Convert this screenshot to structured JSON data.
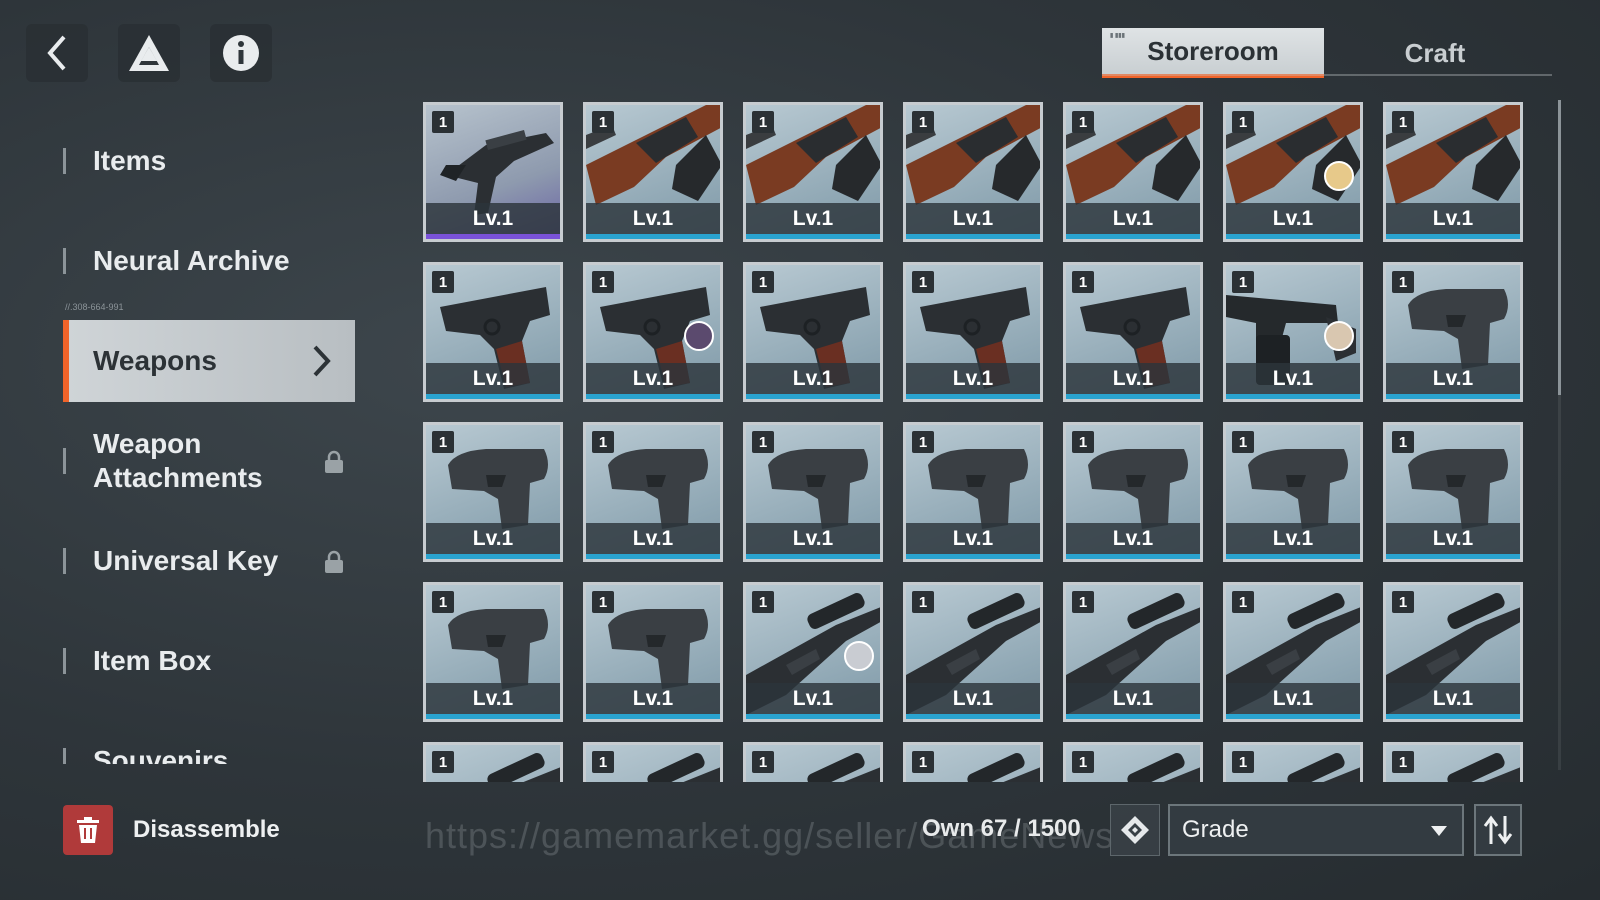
{
  "header": {
    "back_icon": "chevron-left-icon",
    "logo_icon": "triangle-logo-icon",
    "info_icon": "info-icon",
    "tabs": [
      {
        "label": "Storeroom",
        "active": true
      },
      {
        "label": "Craft",
        "active": false
      }
    ]
  },
  "sidebar": {
    "items": [
      {
        "label": "Items",
        "active": false,
        "locked": false
      },
      {
        "label": "Neural Archive",
        "active": false,
        "locked": false
      },
      {
        "label": "Weapons",
        "active": true,
        "locked": false
      },
      {
        "label": "Weapon Attachments",
        "active": false,
        "locked": true
      },
      {
        "label": "Universal Key",
        "active": false,
        "locked": true
      },
      {
        "label": "Item Box",
        "active": false,
        "locked": false
      },
      {
        "label": "Souvenirs",
        "active": false,
        "locked": false
      }
    ],
    "micro_label": "//.308-664-991"
  },
  "grid": {
    "level_label": "Lv.1",
    "rows": [
      [
        {
          "count": "1",
          "weapon": "smg",
          "rarity": "purple",
          "avatar": false
        },
        {
          "count": "1",
          "weapon": "rifle",
          "rarity": "blue",
          "avatar": false
        },
        {
          "count": "1",
          "weapon": "rifle",
          "rarity": "blue",
          "avatar": false
        },
        {
          "count": "1",
          "weapon": "rifle",
          "rarity": "blue",
          "avatar": false
        },
        {
          "count": "1",
          "weapon": "rifle",
          "rarity": "blue",
          "avatar": false
        },
        {
          "count": "1",
          "weapon": "rifle",
          "rarity": "blue",
          "avatar": true,
          "avatar_color": "#e7c98a"
        },
        {
          "count": "1",
          "weapon": "rifle",
          "rarity": "blue",
          "avatar": false
        }
      ],
      [
        {
          "count": "1",
          "weapon": "pistol",
          "rarity": "blue",
          "avatar": false
        },
        {
          "count": "1",
          "weapon": "pistol",
          "rarity": "blue",
          "avatar": true,
          "avatar_color": "#5b4a6e"
        },
        {
          "count": "1",
          "weapon": "pistol",
          "rarity": "blue",
          "avatar": false
        },
        {
          "count": "1",
          "weapon": "pistol",
          "rarity": "blue",
          "avatar": false
        },
        {
          "count": "1",
          "weapon": "pistol",
          "rarity": "blue",
          "avatar": false
        },
        {
          "count": "1",
          "weapon": "tommy",
          "rarity": "blue",
          "avatar": true,
          "avatar_color": "#d9c7b0"
        },
        {
          "count": "1",
          "weapon": "compact",
          "rarity": "blue",
          "avatar": false
        }
      ],
      [
        {
          "count": "1",
          "weapon": "compact",
          "rarity": "blue",
          "avatar": false
        },
        {
          "count": "1",
          "weapon": "compact",
          "rarity": "blue",
          "avatar": false
        },
        {
          "count": "1",
          "weapon": "compact",
          "rarity": "blue",
          "avatar": false
        },
        {
          "count": "1",
          "weapon": "compact",
          "rarity": "blue",
          "avatar": false
        },
        {
          "count": "1",
          "weapon": "compact",
          "rarity": "blue",
          "avatar": false
        },
        {
          "count": "1",
          "weapon": "compact",
          "rarity": "blue",
          "avatar": false
        },
        {
          "count": "1",
          "weapon": "compact",
          "rarity": "blue",
          "avatar": false
        }
      ],
      [
        {
          "count": "1",
          "weapon": "compact",
          "rarity": "blue",
          "avatar": false
        },
        {
          "count": "1",
          "weapon": "compact",
          "rarity": "blue",
          "avatar": false
        },
        {
          "count": "1",
          "weapon": "sniper",
          "rarity": "blue",
          "avatar": true,
          "avatar_color": "#c9ccd2"
        },
        {
          "count": "1",
          "weapon": "sniper",
          "rarity": "blue",
          "avatar": false
        },
        {
          "count": "1",
          "weapon": "sniper",
          "rarity": "blue",
          "avatar": false
        },
        {
          "count": "1",
          "weapon": "sniper",
          "rarity": "blue",
          "avatar": false
        },
        {
          "count": "1",
          "weapon": "sniper",
          "rarity": "blue",
          "avatar": false
        }
      ],
      [
        {
          "count": "1",
          "weapon": "sniper",
          "rarity": "blue",
          "avatar": false
        },
        {
          "count": "1",
          "weapon": "sniper",
          "rarity": "blue",
          "avatar": false
        },
        {
          "count": "1",
          "weapon": "sniper",
          "rarity": "blue",
          "avatar": false
        },
        {
          "count": "1",
          "weapon": "sniper",
          "rarity": "blue",
          "avatar": false
        },
        {
          "count": "1",
          "weapon": "sniper",
          "rarity": "blue",
          "avatar": false
        },
        {
          "count": "1",
          "weapon": "sniper",
          "rarity": "blue",
          "avatar": false
        },
        {
          "count": "1",
          "weapon": "sniper",
          "rarity": "blue",
          "avatar": false
        }
      ]
    ]
  },
  "footer": {
    "disassemble_label": "Disassemble",
    "watermark": "https://gamemarket.gg/seller/GameNews",
    "own_label": "Own 67 / 1500",
    "filter_icon": "diamond-filter-icon",
    "sort_value": "Grade",
    "sort_icon": "sort-order-icon"
  },
  "colors": {
    "accent": "#f0642a",
    "blue_rarity": "#2aa3cf",
    "purple_rarity": "#7a52d9",
    "danger": "#b03a3a"
  }
}
